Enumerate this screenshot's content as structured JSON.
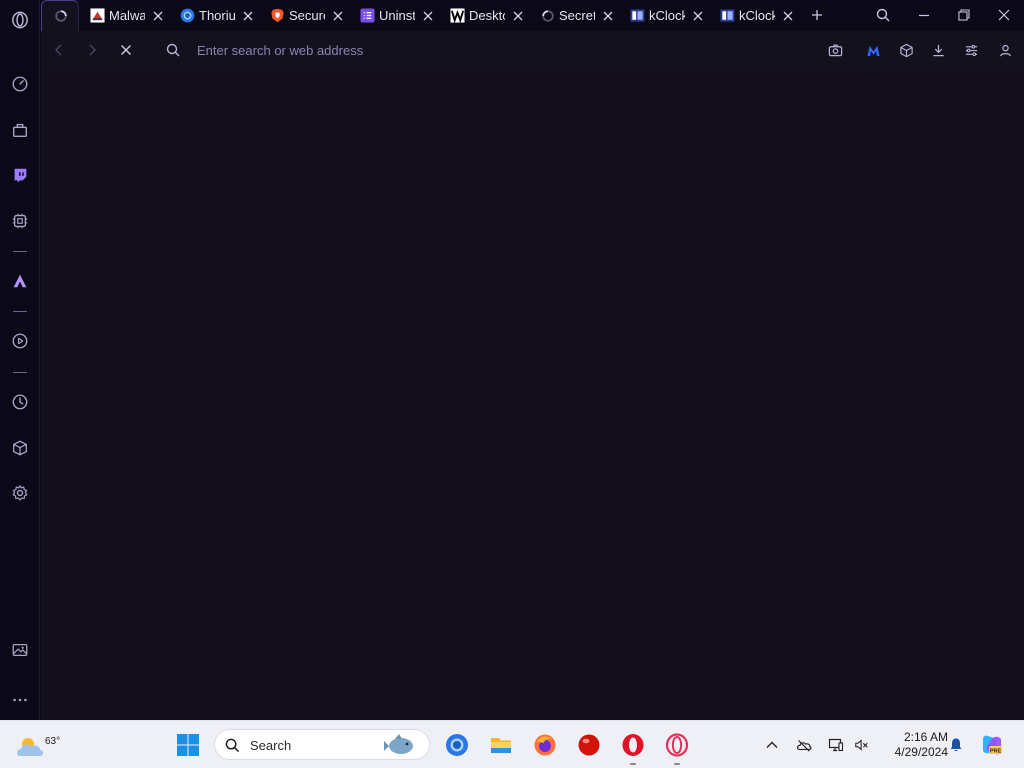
{
  "browser": {
    "tabs": [
      {
        "title": "",
        "favicon": "opera-loading-icon",
        "active": true
      },
      {
        "title": "Malwa",
        "favicon": "malwarebytes-favicon"
      },
      {
        "title": "Thoriu",
        "favicon": "thorium-favicon"
      },
      {
        "title": "Secure",
        "favicon": "brave-favicon"
      },
      {
        "title": "Uninst",
        "favicon": "list-favicon"
      },
      {
        "title": "Deskto",
        "favicon": "wikipedia-favicon"
      },
      {
        "title": "Secret",
        "favicon": "loading-spinner-favicon"
      },
      {
        "title": "kClock",
        "favicon": "kclock-favicon"
      },
      {
        "title": "kClock",
        "favicon": "kclock-favicon"
      }
    ],
    "address_bar": {
      "placeholder": "Enter search or web address",
      "value": ""
    },
    "sidebar_items": [
      "speed-dial",
      "shopping-bag",
      "twitch",
      "extensions",
      "aria",
      "player",
      "history",
      "cube-3d",
      "settings",
      "image-gallery",
      "more"
    ],
    "colors": {
      "accent": "#7b5cf2",
      "background": "#0b0917",
      "content": "#13101c"
    }
  },
  "taskbar": {
    "weather_temp": "63°",
    "search_label": "Search",
    "time": "2:16 AM",
    "date": "4/29/2024"
  }
}
